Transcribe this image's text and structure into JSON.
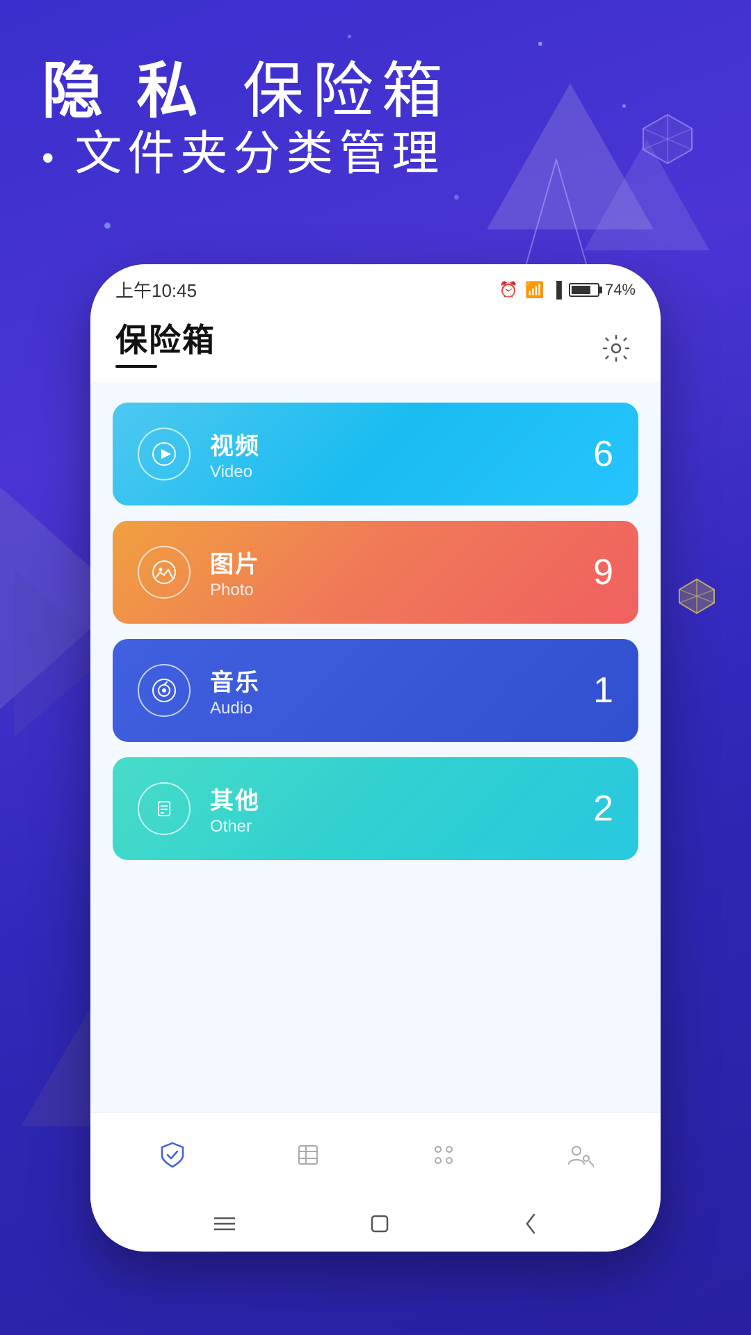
{
  "background": {
    "gradient_start": "#3a2fcc",
    "gradient_end": "#2820a0"
  },
  "heading": {
    "line1_part1": "隐 私",
    "line1_part2": "保险箱",
    "line2": "文件夹分类管理"
  },
  "status_bar": {
    "time": "上午10:45",
    "battery_percent": "74%"
  },
  "app_header": {
    "title": "保险箱",
    "settings_label": "设置"
  },
  "categories": [
    {
      "id": "video",
      "label_cn": "视频",
      "label_en": "Video",
      "count": "6",
      "icon": "▶",
      "color_class": "card-video"
    },
    {
      "id": "photo",
      "label_cn": "图片",
      "label_en": "Photo",
      "count": "9",
      "icon": "⛰",
      "color_class": "card-photo"
    },
    {
      "id": "audio",
      "label_cn": "音乐",
      "label_en": "Audio",
      "count": "1",
      "icon": "♪",
      "color_class": "card-audio"
    },
    {
      "id": "other",
      "label_cn": "其他",
      "label_en": "Other",
      "count": "2",
      "icon": "📄",
      "color_class": "card-other"
    }
  ],
  "bottom_nav": {
    "items": [
      {
        "id": "safe",
        "icon": "🛡",
        "active": true
      },
      {
        "id": "list",
        "icon": "📋",
        "active": false
      },
      {
        "id": "apps",
        "icon": "⠿",
        "active": false
      },
      {
        "id": "profile",
        "icon": "👤",
        "active": false
      }
    ]
  },
  "system_nav": {
    "menu_icon": "☰",
    "home_icon": "⬜",
    "back_icon": "‹"
  }
}
